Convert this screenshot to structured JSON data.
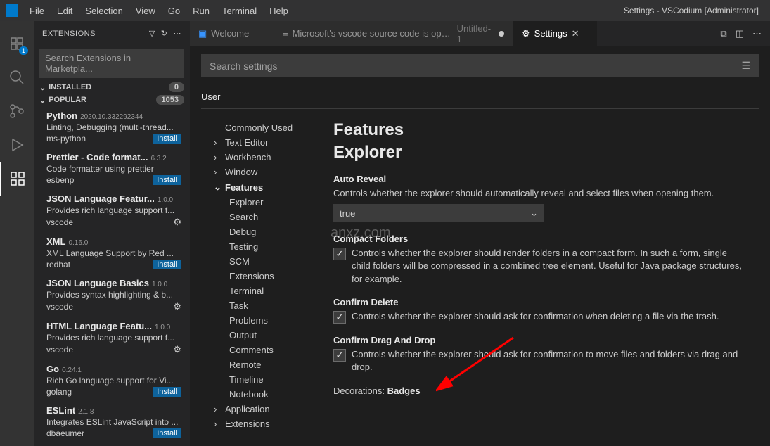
{
  "window": {
    "title": "Settings - VSCodium [Administrator]"
  },
  "menu": [
    "File",
    "Edit",
    "Selection",
    "View",
    "Go",
    "Run",
    "Terminal",
    "Help"
  ],
  "activity": {
    "explorer_badge": "1"
  },
  "sidebar": {
    "title": "EXTENSIONS",
    "search_placeholder": "Search Extensions in Marketpla...",
    "sections": {
      "installed": {
        "label": "INSTALLED",
        "count": "0"
      },
      "popular": {
        "label": "POPULAR",
        "count": "1053"
      }
    },
    "install_label": "Install",
    "extensions": [
      {
        "name": "Python",
        "ver": "2020.10.332292344",
        "desc": "Linting, Debugging (multi-thread...",
        "pub": "ms-python",
        "action": "install"
      },
      {
        "name": "Prettier - Code format...",
        "ver": "6.3.2",
        "desc": "Code formatter using prettier",
        "pub": "esbenp",
        "action": "install"
      },
      {
        "name": "JSON Language Featur...",
        "ver": "1.0.0",
        "desc": "Provides rich language support f...",
        "pub": "vscode",
        "action": "gear"
      },
      {
        "name": "XML",
        "ver": "0.16.0",
        "desc": "XML Language Support by Red ...",
        "pub": "redhat",
        "action": "install"
      },
      {
        "name": "JSON Language Basics",
        "ver": "1.0.0",
        "desc": "Provides syntax highlighting & b...",
        "pub": "vscode",
        "action": "gear"
      },
      {
        "name": "HTML Language Featu...",
        "ver": "1.0.0",
        "desc": "Provides rich language support f...",
        "pub": "vscode",
        "action": "gear"
      },
      {
        "name": "Go",
        "ver": "0.24.1",
        "desc": "Rich Go language support for Vi...",
        "pub": "golang",
        "action": "install"
      },
      {
        "name": "ESLint",
        "ver": "2.1.8",
        "desc": "Integrates ESLint JavaScript into ...",
        "pub": "dbaeumer",
        "action": "install"
      }
    ]
  },
  "tabs": [
    {
      "label": "Welcome",
      "kind": "welcome"
    },
    {
      "label": "Microsoft's vscode source code is open s",
      "suffix": "Untitled-1",
      "kind": "dirty"
    },
    {
      "label": "Settings",
      "kind": "active"
    }
  ],
  "settings": {
    "search_placeholder": "Search settings",
    "scope_tab": "User",
    "toc": [
      {
        "label": "Commonly Used",
        "level": 1,
        "chev": ""
      },
      {
        "label": "Text Editor",
        "level": 1,
        "chev": "›"
      },
      {
        "label": "Workbench",
        "level": 1,
        "chev": "›"
      },
      {
        "label": "Window",
        "level": 1,
        "chev": "›"
      },
      {
        "label": "Features",
        "level": 1,
        "chev": "⌄",
        "bold": true
      },
      {
        "label": "Explorer",
        "level": 2
      },
      {
        "label": "Search",
        "level": 2
      },
      {
        "label": "Debug",
        "level": 2
      },
      {
        "label": "Testing",
        "level": 2
      },
      {
        "label": "SCM",
        "level": 2
      },
      {
        "label": "Extensions",
        "level": 2
      },
      {
        "label": "Terminal",
        "level": 2
      },
      {
        "label": "Task",
        "level": 2
      },
      {
        "label": "Problems",
        "level": 2
      },
      {
        "label": "Output",
        "level": 2
      },
      {
        "label": "Comments",
        "level": 2
      },
      {
        "label": "Remote",
        "level": 2
      },
      {
        "label": "Timeline",
        "level": 2
      },
      {
        "label": "Notebook",
        "level": 2
      },
      {
        "label": "Application",
        "level": 1,
        "chev": "›"
      },
      {
        "label": "Extensions",
        "level": 1,
        "chev": "›"
      }
    ],
    "breadcrumb": [
      "Features",
      "Explorer"
    ],
    "items": {
      "autoReveal": {
        "title": "Auto Reveal",
        "desc": "Controls whether the explorer should automatically reveal and select files when opening them.",
        "value": "true"
      },
      "compactFolders": {
        "title": "Compact Folders",
        "desc": "Controls whether the explorer should render folders in a compact form. In such a form, single child folders will be compressed in a combined tree element. Useful for Java package structures, for example."
      },
      "confirmDelete": {
        "title": "Confirm Delete",
        "desc": "Controls whether the explorer should ask for confirmation when deleting a file via the trash."
      },
      "confirmDragDrop": {
        "title": "Confirm Drag And Drop",
        "desc": "Controls whether the explorer should ask for confirmation to move files and folders via drag and drop."
      },
      "decorations": {
        "label": "Decorations:",
        "value": "Badges"
      }
    }
  },
  "watermark": "anxz.com"
}
